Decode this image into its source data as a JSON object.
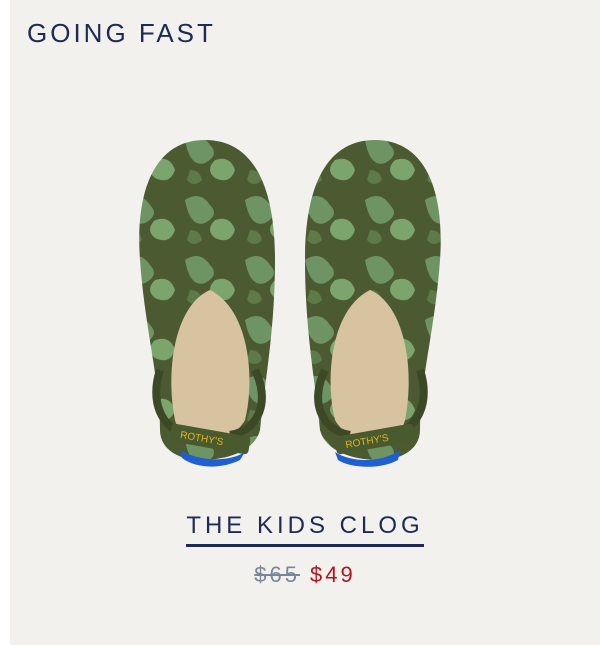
{
  "badge": {
    "text": "GOING FAST"
  },
  "product": {
    "title": "THE KIDS CLOG",
    "original_price": "$65",
    "sale_price": "$49",
    "brand_marking": "ROTHY'S",
    "image_alt": "Pair of green camo kids clogs"
  },
  "colors": {
    "background": "#f2f1ee",
    "navy": "#1c2a55",
    "sale_red": "#b5121b",
    "strike_gray": "#7a8599",
    "camo_dark": "#4a5a2f",
    "camo_light": "#7aa06a"
  }
}
